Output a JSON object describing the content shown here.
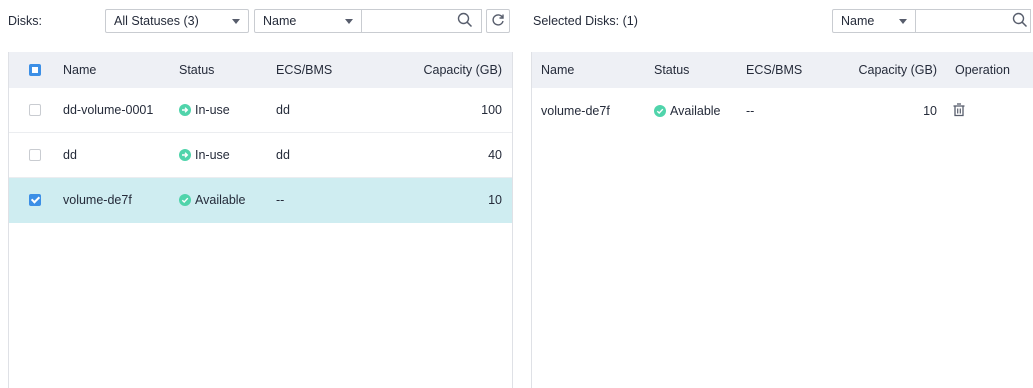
{
  "left": {
    "label": "Disks:",
    "status_filter": "All Statuses (3)",
    "field_select": "Name",
    "search_value": "",
    "columns": [
      "Name",
      "Status",
      "ECS/BMS",
      "Capacity (GB)"
    ],
    "rows": [
      {
        "name": "dd-volume-0001",
        "status": "In-use",
        "ecs": "dd",
        "capacity": "100",
        "checked": false
      },
      {
        "name": "dd",
        "status": "In-use",
        "ecs": "dd",
        "capacity": "40",
        "checked": false
      },
      {
        "name": "volume-de7f",
        "status": "Available",
        "ecs": "--",
        "capacity": "10",
        "checked": true
      }
    ]
  },
  "right": {
    "label": "Selected Disks: (1)",
    "field_select": "Name",
    "search_value": "",
    "columns": [
      "Name",
      "Status",
      "ECS/BMS",
      "Capacity (GB)",
      "Operation"
    ],
    "rows": [
      {
        "name": "volume-de7f",
        "status": "Available",
        "ecs": "--",
        "capacity": "10"
      }
    ]
  },
  "icons": {
    "search": "search-icon",
    "refresh": "refresh-icon",
    "delete": "trash-icon",
    "inuse": "arrow-right-circle-icon",
    "available": "check-circle-icon"
  },
  "colors": {
    "accent": "#3c8fe6",
    "status_green": "#50d4ab",
    "selected_row": "#cfedf1",
    "header_bg": "#eef0f5"
  }
}
